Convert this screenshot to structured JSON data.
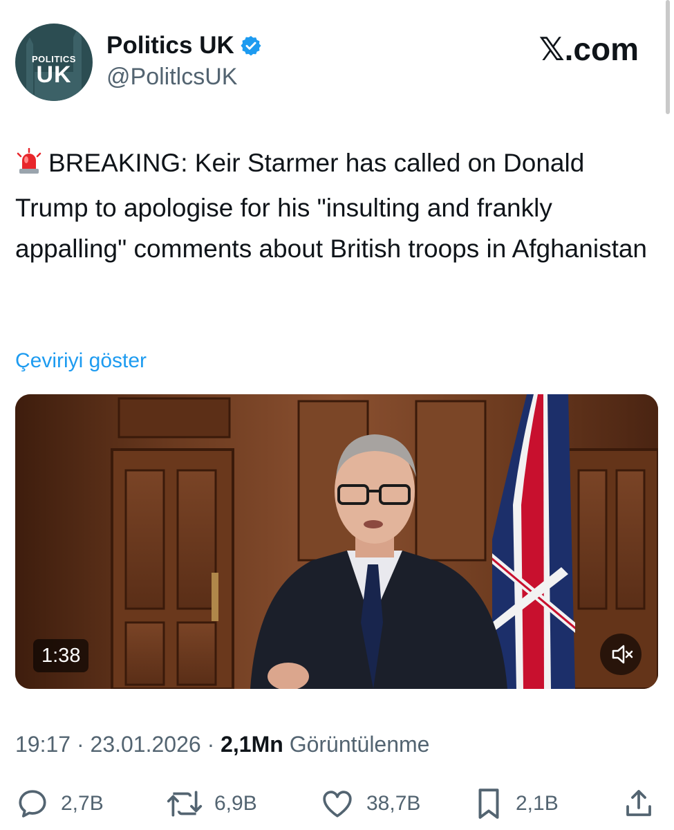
{
  "header": {
    "display_name": "Politics UK",
    "handle": "@PolitlcsUK",
    "brand": "𝕏.com",
    "avatar": {
      "line1": "POLITICS",
      "line2": "UK"
    }
  },
  "tweet": {
    "emoji": "🚨",
    "text": "BREAKING: Keir Starmer has called on Donald Trump to apologise for his \"insulting and frankly appalling\" comments about British troops in Afghanistan",
    "translate_label": "Çeviriyi göster"
  },
  "video": {
    "duration": "1:38",
    "mute_icon": "speaker-muted-icon"
  },
  "meta": {
    "time": "19:17",
    "separator": "·",
    "date": "23.01.2026",
    "views_count": "2,1Mn",
    "views_label": "Görüntülenme"
  },
  "actions": {
    "replies": "2,7B",
    "reposts": "6,9B",
    "likes": "38,7B",
    "bookmarks": "2,1B"
  },
  "colors": {
    "accent": "#1d9bf0",
    "secondary_text": "#536471",
    "avatar_bg": "#2c4d52"
  }
}
